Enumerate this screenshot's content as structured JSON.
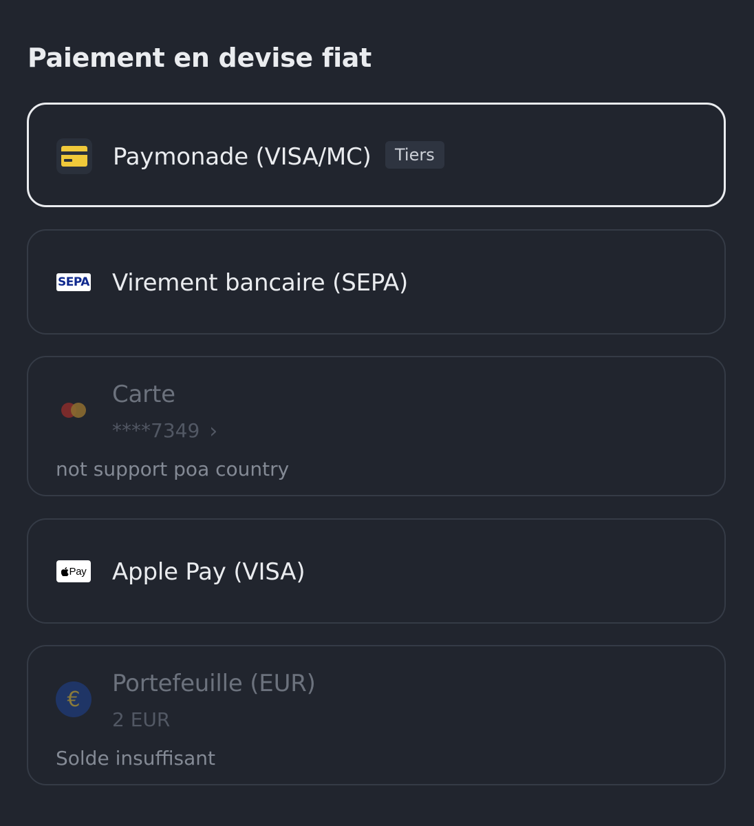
{
  "page": {
    "title": "Paiement en devise fiat"
  },
  "options": [
    {
      "label": "Paymonade (VISA/MC)",
      "badge": "Tiers",
      "icon": "credit-card-icon",
      "selected": true,
      "disabled": false
    },
    {
      "label": "Virement bancaire (SEPA)",
      "icon": "sepa-logo-icon",
      "icon_text": "SEPA",
      "selected": false,
      "disabled": false
    },
    {
      "label": "Carte",
      "sub": "****7349",
      "note": "not support poa country",
      "icon": "mastercard-icon",
      "selected": false,
      "disabled": true
    },
    {
      "label": "Apple Pay (VISA)",
      "icon": "apple-pay-icon",
      "icon_text": "Pay",
      "selected": false,
      "disabled": false
    },
    {
      "label": "Portefeuille (EUR)",
      "sub": "2 EUR",
      "note": "Solde insuffisant",
      "icon": "euro-coin-icon",
      "icon_text": "€",
      "selected": false,
      "disabled": true
    }
  ],
  "colors": {
    "background": "#21252e",
    "border": "#353b46",
    "selected_border": "#eaecef",
    "text_primary": "#eaecef",
    "text_disabled": "#6c727d",
    "card_yellow": "#f0c93a",
    "sepa_blue": "#10298e",
    "euro_blue": "#1f3566"
  }
}
